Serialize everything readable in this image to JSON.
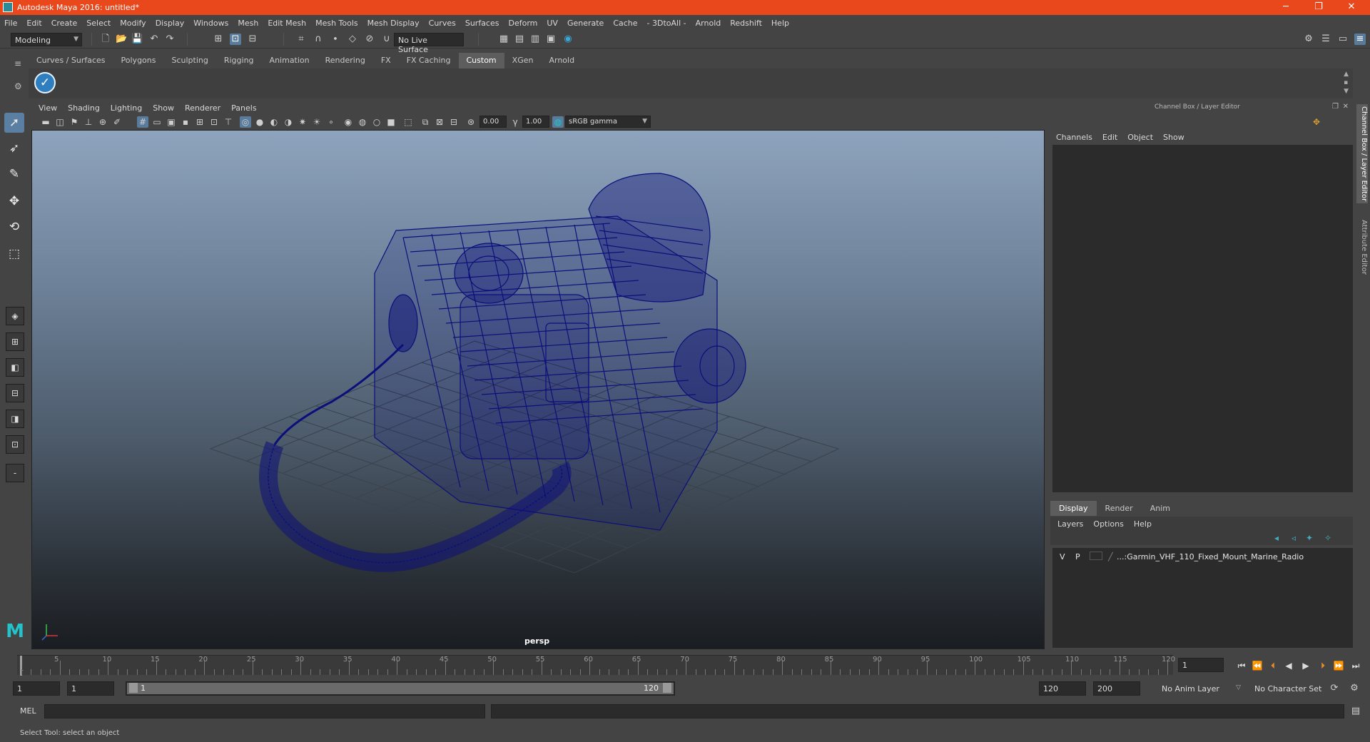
{
  "window": {
    "title": "Autodesk Maya 2016: untitled*",
    "min_glyph": "─",
    "max_glyph": "❐",
    "close_glyph": "✕"
  },
  "menubar": [
    "File",
    "Edit",
    "Create",
    "Select",
    "Modify",
    "Display",
    "Windows",
    "Mesh",
    "Edit Mesh",
    "Mesh Tools",
    "Mesh Display",
    "Curves",
    "Surfaces",
    "Deform",
    "UV",
    "Generate",
    "Cache",
    "- 3DtoAll -",
    "Arnold",
    "Redshift",
    "Help"
  ],
  "statusline": {
    "mode": "Modeling",
    "live_surface": "No Live Surface"
  },
  "shelf": {
    "tabs": [
      "Curves / Surfaces",
      "Polygons",
      "Sculpting",
      "Rigging",
      "Animation",
      "Rendering",
      "FX",
      "FX Caching",
      "Custom",
      "XGen",
      "Arnold"
    ],
    "active_tab": "Custom"
  },
  "panel": {
    "menu": [
      "View",
      "Shading",
      "Lighting",
      "Show",
      "Renderer",
      "Panels"
    ],
    "exposure": "0.00",
    "gamma": "1.00",
    "colorspace": "sRGB gamma",
    "camera": "persp"
  },
  "channelbox": {
    "header": "Channel Box / Layer Editor",
    "menu": [
      "Channels",
      "Edit",
      "Object",
      "Show"
    ],
    "side_tabs": [
      "Channel Box / Layer Editor",
      "Attribute Editor"
    ]
  },
  "layers": {
    "tabs": [
      "Display",
      "Render",
      "Anim"
    ],
    "active_tab": "Display",
    "menu": [
      "Layers",
      "Options",
      "Help"
    ],
    "rows": [
      {
        "v": "V",
        "p": "P",
        "name": "...:Garmin_VHF_110_Fixed_Mount_Marine_Radio"
      }
    ]
  },
  "timeline": {
    "labels": [
      "1",
      "5",
      "10",
      "15",
      "20",
      "25",
      "30",
      "35",
      "40",
      "45",
      "50",
      "55",
      "60",
      "65",
      "70",
      "75",
      "80",
      "85",
      "90",
      "95",
      "100",
      "105",
      "110",
      "115",
      "120"
    ],
    "current_frame": "1"
  },
  "range": {
    "start": "1",
    "playback_start": "1",
    "slider_start": "1",
    "slider_end": "120",
    "playback_end": "120",
    "end": "200",
    "anim_layer": "No Anim Layer",
    "character_set": "No Character Set"
  },
  "cmdline": {
    "label": "MEL"
  },
  "helpline": {
    "text": "Select Tool: select an object"
  },
  "colors": {
    "titlebar": "#e8481c",
    "active_tool": "#5b7fa3",
    "wireframe": "#0c0f7a"
  }
}
